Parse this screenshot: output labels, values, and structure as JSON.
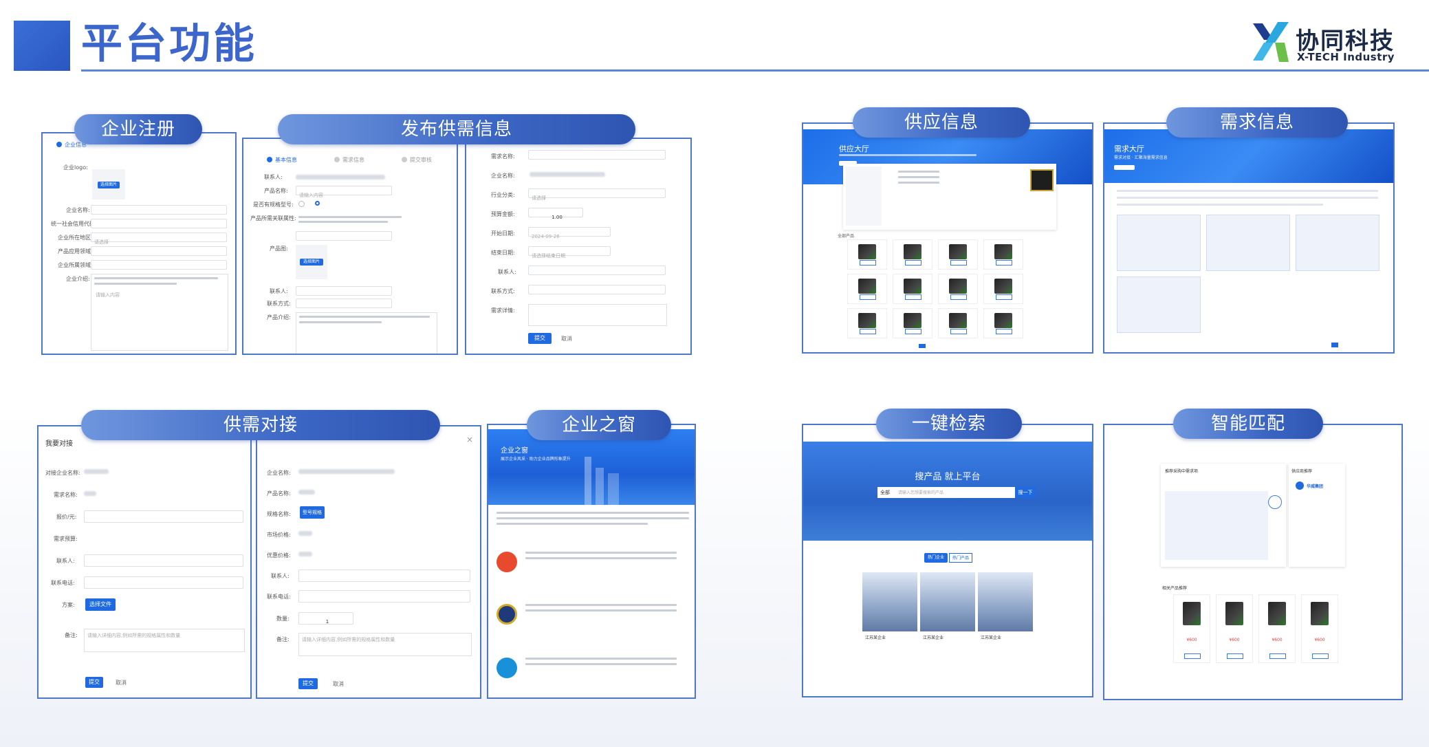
{
  "header": {
    "title": "平台功能",
    "logo_cn": "协同科技",
    "logo_en": "X-TECH Industry"
  },
  "colors": {
    "accent": "#3d66cc",
    "panel_border": "#4d78c9",
    "button": "#1f6ae0"
  },
  "pills": {
    "register": "企业注册",
    "publish": "发布供需信息",
    "supply": "供应信息",
    "demand": "需求信息",
    "matchmaking": "供需对接",
    "window": "企业之窗",
    "search": "一键检索",
    "smart": "智能匹配"
  },
  "register_form": {
    "step1": "企业信息",
    "logo_label": "企业logo:",
    "upload_btn": "选择图片",
    "fields": [
      "企业名称:",
      "统一社会信用代码:",
      "企业所在地区:",
      "产品应用领域:",
      "企业所属领域:",
      "企业介绍:"
    ],
    "region_value": "请选择",
    "intro_placeholder": "请输入内容"
  },
  "publish_form": {
    "steps": [
      "基本信息",
      "需求信息",
      "提交审核"
    ],
    "fields_left": [
      "联系人:",
      "产品名称:",
      "是否有规格型号:",
      "产品所需关联属性:",
      "产品图:",
      "联系人:",
      "联系方式:",
      "产品介绍:"
    ],
    "upload_btn": "选择图片",
    "input_placeholder": "请输入内容",
    "fields_right": [
      "需求名称:",
      "企业名称:",
      "行业分类:",
      "预算金额:",
      "开始日期:",
      "结束日期:",
      "联系人:",
      "联系方式:",
      "需求详情:"
    ],
    "industry_placeholder": "请选择",
    "budget_value": "1.00",
    "start_date": "2024-09-26",
    "end_placeholder": "请选择结束日期",
    "submit": "提交",
    "cancel": "取消"
  },
  "matchmaking": {
    "left_title": "我要对接",
    "left_fields": [
      "对接企业名称:",
      "需求名称:",
      "报价/元:",
      "需求预算:",
      "联系人:",
      "联系电话:",
      "方案:",
      "备注:"
    ],
    "upload_btn": "选择文件",
    "remark_placeholder": "请输入详细内容,例如所需的规格属性和数量",
    "right_fields": [
      "企业名称:",
      "产品名称:",
      "规格名称:",
      "市场价格:",
      "优惠价格:",
      "联系人:",
      "联系电话:",
      "数量:",
      "备注:"
    ],
    "spec_tag": "型号规格",
    "qty": "1",
    "submit": "提交",
    "cancel": "取消",
    "close": "×"
  },
  "window": {
    "hero_title": "企业之窗",
    "hero_sub": "展示企业风采 · 助力企业品牌形象提升"
  },
  "supply": {
    "hero_title": "供应大厅",
    "list_title": "全部产品"
  },
  "demand": {
    "hero_title": "需求大厅",
    "hero_sub": "需求对接 · 汇聚海量需求信息"
  },
  "search": {
    "hero_title": "搜产品 就上平台",
    "search_btn": "搜一下",
    "select_label": "全部",
    "search_placeholder": "请输入您想要搜索的产品",
    "tab_hot": "热门企业",
    "tab_new": "热门产品",
    "building_label": "江苏某企业"
  },
  "smart": {
    "card_title": "推荐采购中需求项",
    "side_title": "供应商推荐",
    "side_company": "华威集团",
    "rec_title": "相关产品推荐",
    "price": "¥600"
  }
}
